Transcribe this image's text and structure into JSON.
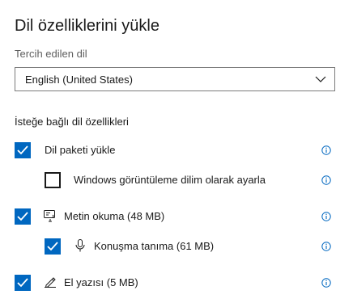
{
  "title": "Dil özelliklerini yükle",
  "preferred_language": {
    "label": "Tercih edilen dil",
    "selected": "English (United States)"
  },
  "optional_features": {
    "label": "İsteğe bağlı dil özellikleri",
    "items": [
      {
        "label": "Dil paketi yükle",
        "checked": true,
        "icon": null
      },
      {
        "label": "Windows görüntüleme dilim olarak ayarla",
        "checked": false,
        "icon": null
      },
      {
        "label": "Metin okuma (48 MB)",
        "checked": true,
        "icon": "text-to-speech-icon"
      },
      {
        "label": "Konuşma tanıma (61 MB)",
        "checked": true,
        "icon": "microphone-icon"
      },
      {
        "label": "El yazısı (5 MB)",
        "checked": true,
        "icon": "handwriting-icon"
      }
    ]
  },
  "colors": {
    "accent": "#0067c0",
    "text": "#1a1a1a",
    "secondary_text": "#5e5e5e"
  }
}
